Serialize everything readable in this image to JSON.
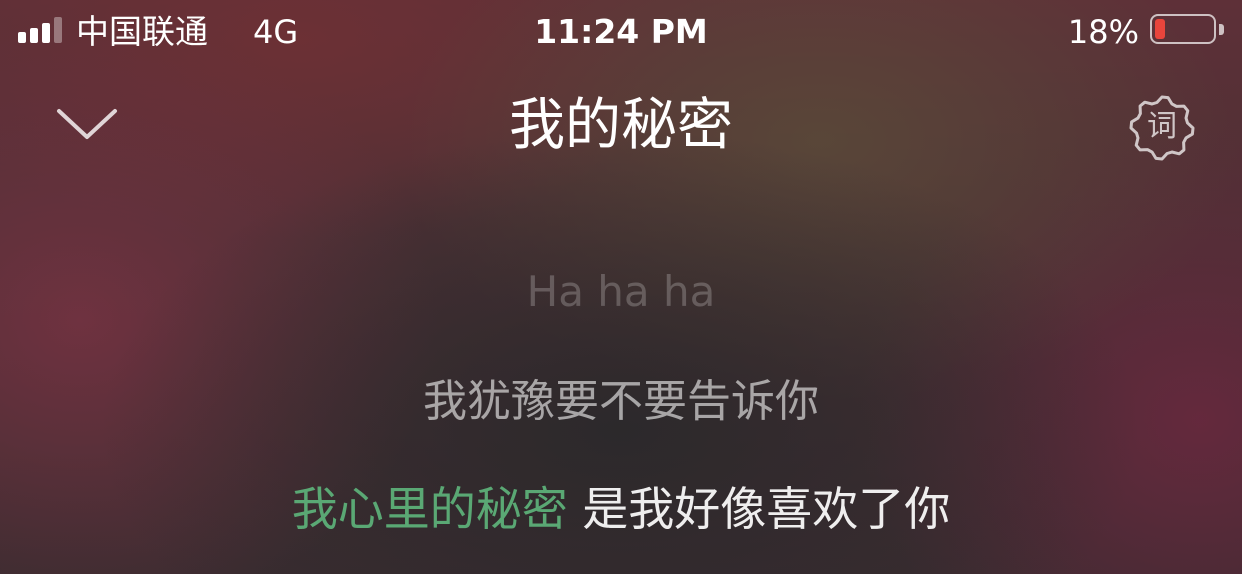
{
  "status_bar": {
    "carrier": "中国联通",
    "network": "4G",
    "time": "11:24 PM",
    "battery_percent_label": "18%",
    "battery_level": 0.18,
    "battery_color": "#e8453c",
    "signal_bars_active": 3,
    "signal_bars_total": 4
  },
  "header": {
    "collapse_icon": "chevron-down-icon",
    "title": "我的秘密",
    "lyrics_settings_icon": "lyrics-settings-icon",
    "lyrics_settings_glyph": "词"
  },
  "lyrics": {
    "lines": [
      {
        "text": "Ha ha ha"
      },
      {
        "text": "我犹豫要不要告诉你"
      },
      {
        "sung": "我心里的秘密",
        "unsung": " 是我好像喜欢了你"
      }
    ],
    "sung_color": "#5aa874"
  }
}
